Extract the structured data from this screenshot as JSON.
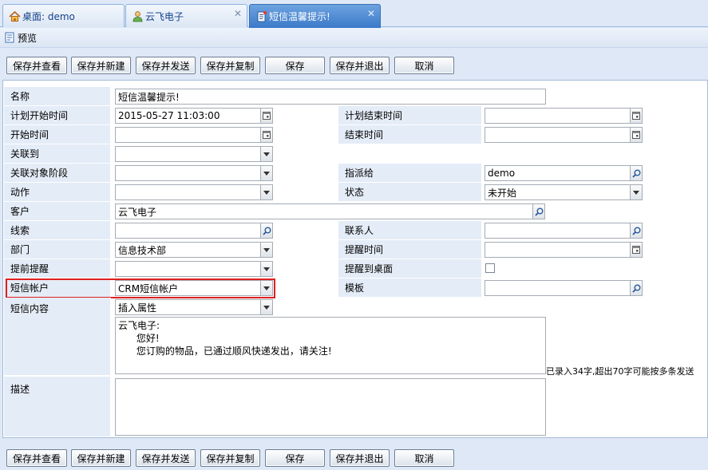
{
  "tabs": [
    {
      "label": "桌面: demo"
    },
    {
      "label": "云飞电子"
    },
    {
      "label": "短信温馨提示!"
    }
  ],
  "preview_label": "预览",
  "toolbar": {
    "save_view": "保存并查看",
    "save_new": "保存并新建",
    "save_send": "保存并发送",
    "save_copy": "保存并复制",
    "save": "保存",
    "save_exit": "保存并退出",
    "cancel": "取消"
  },
  "form": {
    "name_label": "名称",
    "name_value": "短信温馨提示!",
    "plan_start_label": "计划开始时间",
    "plan_start_value": "2015-05-27 11:03:00",
    "plan_end_label": "计划结束时间",
    "plan_end_value": "",
    "start_label": "开始时间",
    "start_value": "",
    "end_label": "结束时间",
    "end_value": "",
    "related_label": "关联到",
    "related_value": "",
    "related_stage_label": "关联对象阶段",
    "related_stage_value": "",
    "assign_label": "指派给",
    "assign_value": "demo",
    "action_label": "动作",
    "action_value": "",
    "status_label": "状态",
    "status_value": "未开始",
    "customer_label": "客户",
    "customer_value": "云飞电子",
    "lead_label": "线索",
    "lead_value": "",
    "contact_label": "联系人",
    "contact_value": "",
    "dept_label": "部门",
    "dept_value": "信息技术部",
    "remind_time_label": "提醒时间",
    "remind_time_value": "",
    "advance_label": "提前提醒",
    "advance_value": "",
    "remind_desktop_label": "提醒到桌面",
    "sms_account_label": "短信帐户",
    "sms_account_value": "CRM短信帐户",
    "template_label": "模板",
    "template_value": "",
    "sms_content_label": "短信内容",
    "insert_attr_value": "插入属性",
    "sms_line1": "云飞电子:",
    "sms_line2": "      您好!",
    "sms_line3": "      您订购的物品，已通过顺风快递发出，请关注!",
    "sms_counter": "已录入34字,超出70字可能按多条发送",
    "desc_label": "描述",
    "desc_value": ""
  },
  "colors": {
    "active_tab": "#3b79c9",
    "label_bg": "#e4ecf7",
    "highlight": "#e02020"
  }
}
